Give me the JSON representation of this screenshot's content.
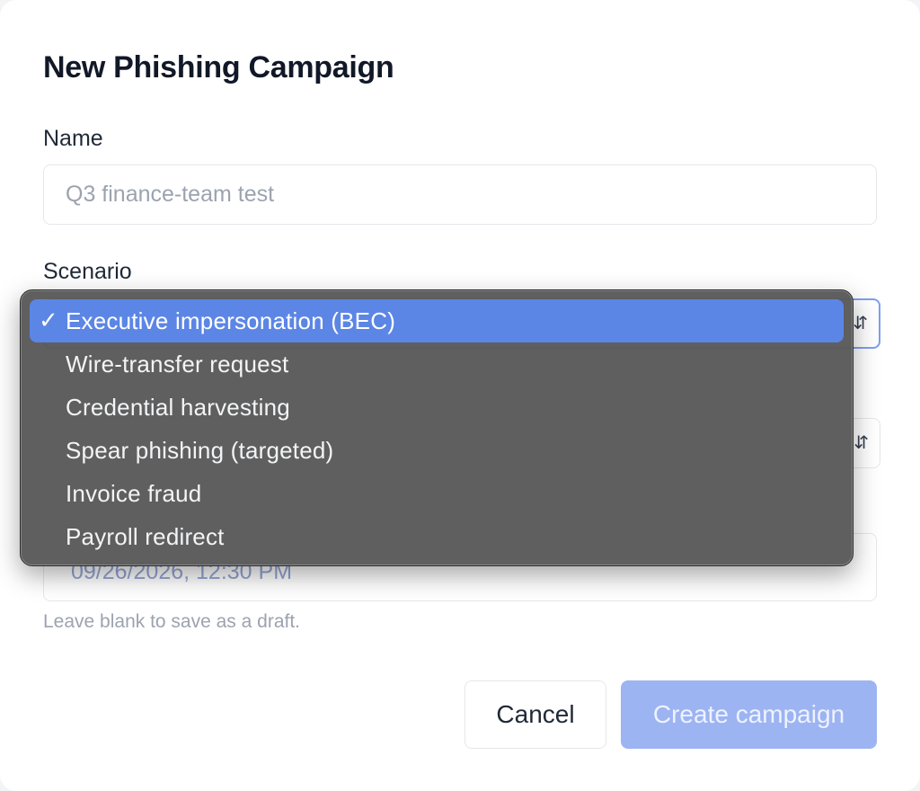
{
  "dialog": {
    "title": "New Phishing Campaign"
  },
  "name_field": {
    "label": "Name",
    "placeholder": "Q3 finance-team test",
    "value": ""
  },
  "scenario_field": {
    "label": "Scenario",
    "selected": "Executive impersonation (BEC)",
    "options": [
      "Executive impersonation (BEC)",
      "Wire-transfer request",
      "Credential harvesting",
      "Spear phishing (targeted)",
      "Invoice fraud",
      "Payroll redirect"
    ]
  },
  "schedule_field": {
    "partial_value": "09/26/2026, 12:30 PM",
    "hint": "Leave blank to save as a draft."
  },
  "buttons": {
    "cancel": "Cancel",
    "create": "Create campaign"
  },
  "icons": {
    "check": "checkmark-icon",
    "select_arrows": "updown-chevron-icon"
  },
  "colors": {
    "accent": "#5c86e5",
    "primary_disabled": "#9db4f2"
  }
}
